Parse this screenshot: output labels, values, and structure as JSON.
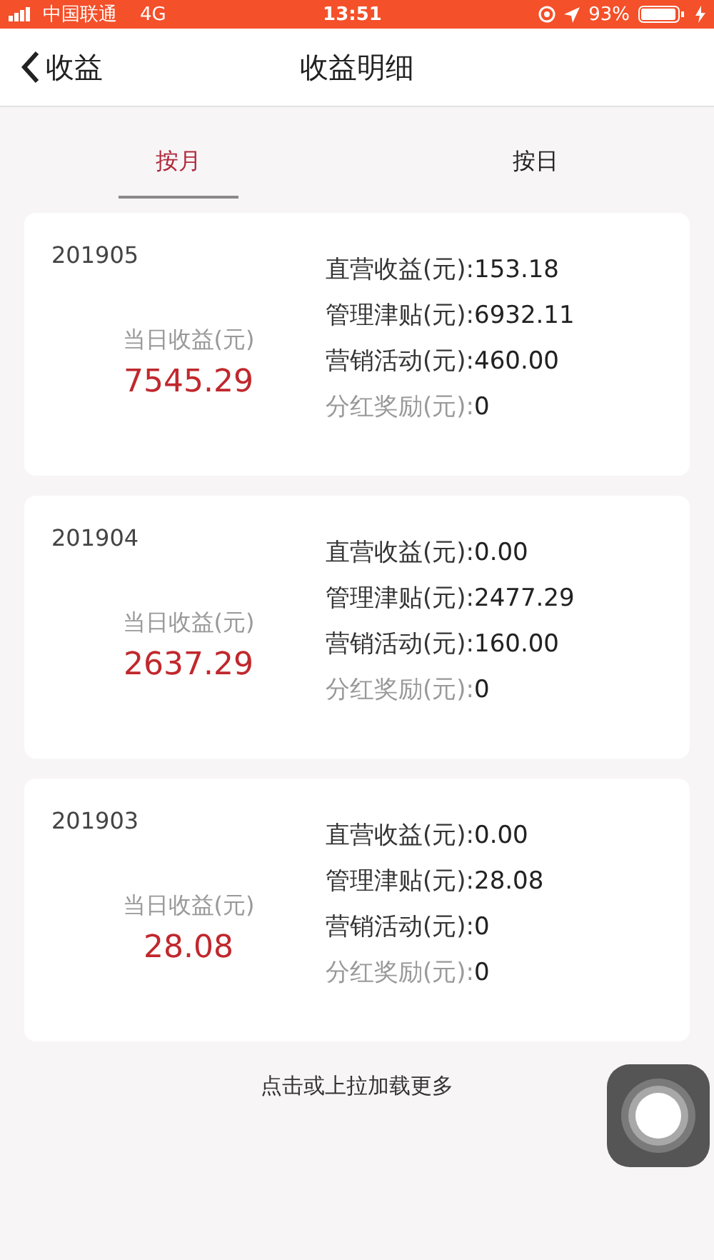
{
  "status_bar": {
    "carrier": "中国联通",
    "network": "4G",
    "time": "13:51",
    "battery": "93%"
  },
  "nav": {
    "back_label": "收益",
    "title": "收益明细"
  },
  "tabs": [
    {
      "label": "按月",
      "selected": true
    },
    {
      "label": "按日",
      "selected": false
    }
  ],
  "records": [
    {
      "period": "201905",
      "total_label": "当日收益(元)",
      "total": "7545.29",
      "items": [
        {
          "label": "直营收益(元):",
          "value": "153.18",
          "dimmed": false
        },
        {
          "label": "管理津贴(元):",
          "value": "6932.11",
          "dimmed": false
        },
        {
          "label": "营销活动(元):",
          "value": "460.00",
          "dimmed": false
        },
        {
          "label": "分红奖励(元):",
          "value": "0",
          "dimmed": true
        }
      ]
    },
    {
      "period": "201904",
      "total_label": "当日收益(元)",
      "total": "2637.29",
      "items": [
        {
          "label": "直营收益(元):",
          "value": "0.00",
          "dimmed": false
        },
        {
          "label": "管理津贴(元):",
          "value": "2477.29",
          "dimmed": false
        },
        {
          "label": "营销活动(元):",
          "value": "160.00",
          "dimmed": false
        },
        {
          "label": "分红奖励(元):",
          "value": "0",
          "dimmed": true
        }
      ]
    },
    {
      "period": "201903",
      "total_label": "当日收益(元)",
      "total": "28.08",
      "items": [
        {
          "label": "直营收益(元):",
          "value": "0.00",
          "dimmed": false
        },
        {
          "label": "管理津贴(元):",
          "value": "28.08",
          "dimmed": false
        },
        {
          "label": "营销活动(元):",
          "value": "0",
          "dimmed": false
        },
        {
          "label": "分红奖励(元):",
          "value": "0",
          "dimmed": true
        }
      ]
    }
  ],
  "load_more": "点击或上拉加载更多"
}
